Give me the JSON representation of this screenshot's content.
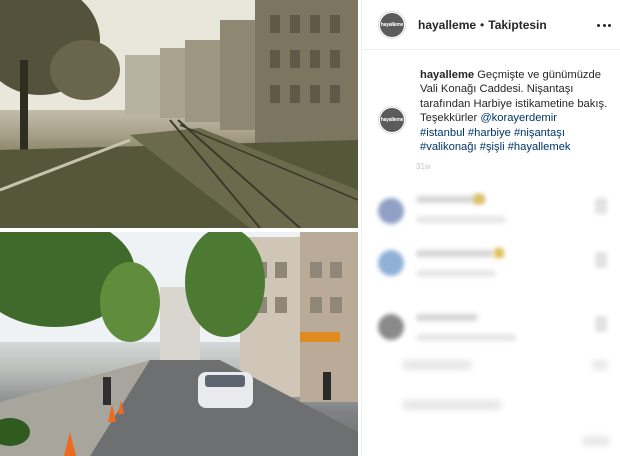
{
  "header": {
    "username": "hayalleme",
    "separator": "•",
    "follow_status": "Takiptesin",
    "avatar_text": "hayalleme"
  },
  "post": {
    "caption_user": "hayalleme",
    "caption_text": "Geçmişte ve günümüzde Vali Konağı Caddesi. Nişantaşı tarafından Harbiye istikametine bakış. Teşekkürler ",
    "mention": "@korayerdemir",
    "hashtags": [
      "#istanbul",
      "#harbiye",
      "#nişantaşı",
      "#valikonağı",
      "#şişli",
      "#hayallemek"
    ],
    "time_faint": "31w"
  },
  "comments_blurred": [
    {
      "avatar_color": "#8ea0c6"
    },
    {
      "avatar_color": "#90b0d8"
    },
    {
      "avatar_color": "#8a8a8a"
    }
  ],
  "colors": {
    "link": "#003569",
    "text": "#262626",
    "border": "#efefef"
  },
  "icons": {
    "more": "more-options-icon"
  }
}
